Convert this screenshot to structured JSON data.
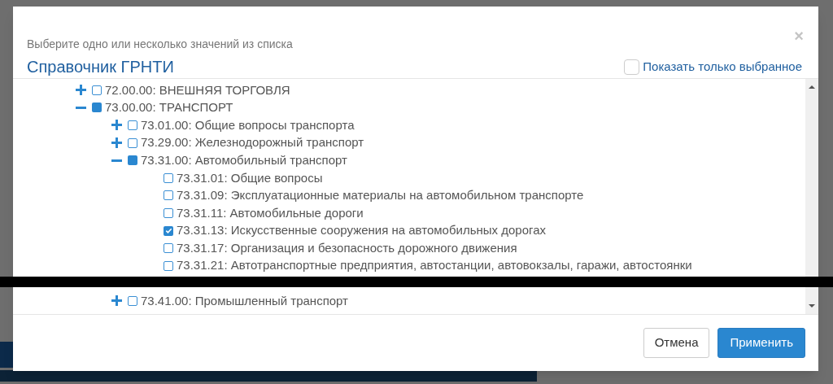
{
  "dialog": {
    "subtitle": "Выберите одно или несколько значений из списка",
    "title": "Справочник ГРНТИ",
    "close": "×",
    "show_selected_only": {
      "label": "Показать только выбранное",
      "checked": false
    },
    "tree": [
      {
        "label": "72.00.00: ВНЕШНЯЯ ТОРГОВЛЯ",
        "checked": false,
        "partial": false,
        "expanded": false
      },
      {
        "label": "73.00.00: ТРАНСПОРТ",
        "checked": false,
        "partial": true,
        "expanded": true,
        "children": [
          {
            "label": "73.01.00: Общие вопросы транспорта",
            "checked": false,
            "partial": false,
            "expanded": false
          },
          {
            "label": "73.29.00: Железнодорожный транспорт",
            "checked": false,
            "partial": false,
            "expanded": false
          },
          {
            "label": "73.31.00: Автомобильный транспорт",
            "checked": false,
            "partial": true,
            "expanded": true,
            "children": [
              {
                "label": "73.31.01: Общие вопросы",
                "checked": false,
                "partial": false
              },
              {
                "label": "73.31.09: Эксплуатационные материалы на автомобильном транспорте",
                "checked": false,
                "partial": false
              },
              {
                "label": "73.31.11: Автомобильные дороги",
                "checked": false,
                "partial": false
              },
              {
                "label": "73.31.13: Искусственные сооружения на автомобильных дорогах",
                "checked": true
              },
              {
                "label": "73.31.17: Организация и безопасность дорожного движения",
                "checked": false,
                "partial": false
              },
              {
                "label": "73.31.21: Автотранспортные предприятия, автостанции, автовокзалы, гаражи, автостоянки",
                "checked": false,
                "partial": false
              }
            ]
          },
          {
            "kind": "redacted"
          },
          {
            "label": "73.41.00: Промышленный транспорт",
            "checked": false,
            "partial": false,
            "expanded": false
          }
        ]
      }
    ],
    "buttons": [
      {
        "label": "Отмена",
        "kind": "secondary"
      },
      {
        "label": "Применить",
        "kind": "primary"
      }
    ]
  }
}
